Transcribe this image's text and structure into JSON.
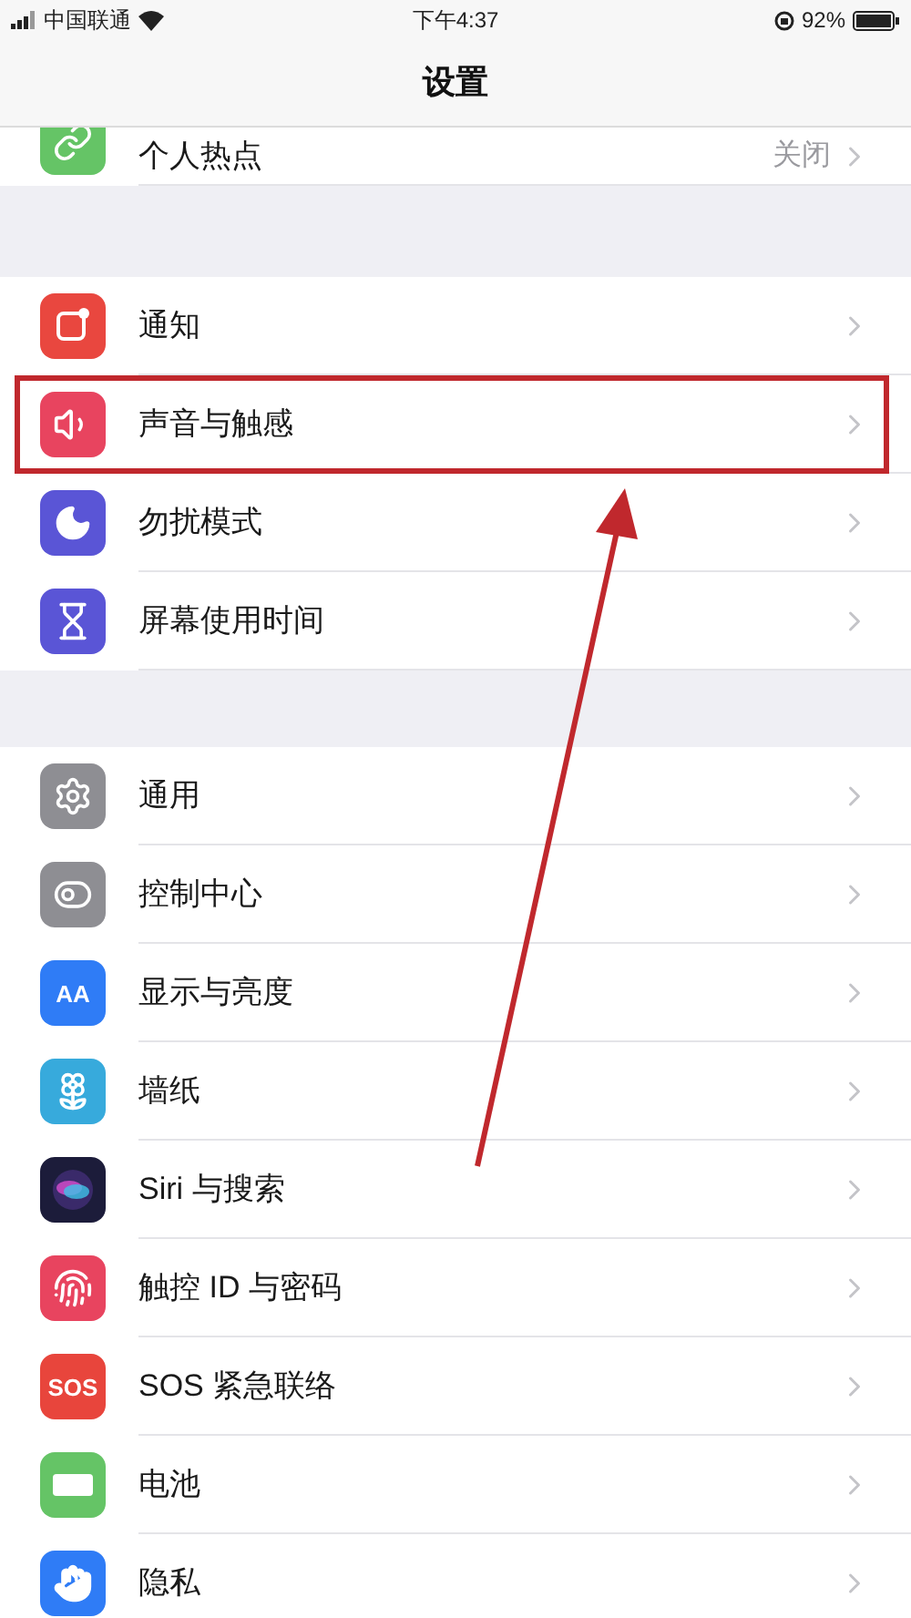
{
  "status_bar": {
    "carrier": "中国联通",
    "time": "下午4:37",
    "battery": "92%"
  },
  "nav": {
    "title": "设置"
  },
  "groups": [
    {
      "items": [
        {
          "label": "个人热点",
          "value": "关闭",
          "kind": "hotspot",
          "color": "#65c466",
          "highlighted": false
        }
      ]
    },
    {
      "items": [
        {
          "label": "通知",
          "kind": "notification",
          "color": "#e9473f",
          "highlighted": false
        },
        {
          "label": "声音与触感",
          "kind": "sound",
          "color": "#e8445f",
          "highlighted": true
        },
        {
          "label": "勿扰模式",
          "kind": "moon",
          "color": "#5a55d6",
          "highlighted": false
        },
        {
          "label": "屏幕使用时间",
          "kind": "hourglass",
          "color": "#5a55d6",
          "highlighted": false
        }
      ]
    },
    {
      "items": [
        {
          "label": "通用",
          "kind": "gear",
          "color": "#8e8e93",
          "highlighted": false
        },
        {
          "label": "控制中心",
          "kind": "toggles",
          "color": "#8e8e93",
          "highlighted": false
        },
        {
          "label": "显示与亮度",
          "kind": "text",
          "icon_text": "AA",
          "color": "#2f7cf6",
          "highlighted": false
        },
        {
          "label": "墙纸",
          "kind": "flower",
          "color": "#37aadc",
          "highlighted": false
        },
        {
          "label": "Siri 与搜索",
          "kind": "siri",
          "color": "#1c1c3a",
          "highlighted": false
        },
        {
          "label": "触控 ID 与密码",
          "kind": "fingerprint",
          "color": "#e8445f",
          "highlighted": false
        },
        {
          "label": "SOS 紧急联络",
          "kind": "text",
          "icon_text": "SOS",
          "color": "#e8453c",
          "highlighted": false
        },
        {
          "label": "电池",
          "kind": "battery",
          "color": "#65c466",
          "highlighted": false
        },
        {
          "label": "隐私",
          "kind": "hand",
          "color": "#2f7cf6",
          "highlighted": false
        }
      ]
    }
  ]
}
